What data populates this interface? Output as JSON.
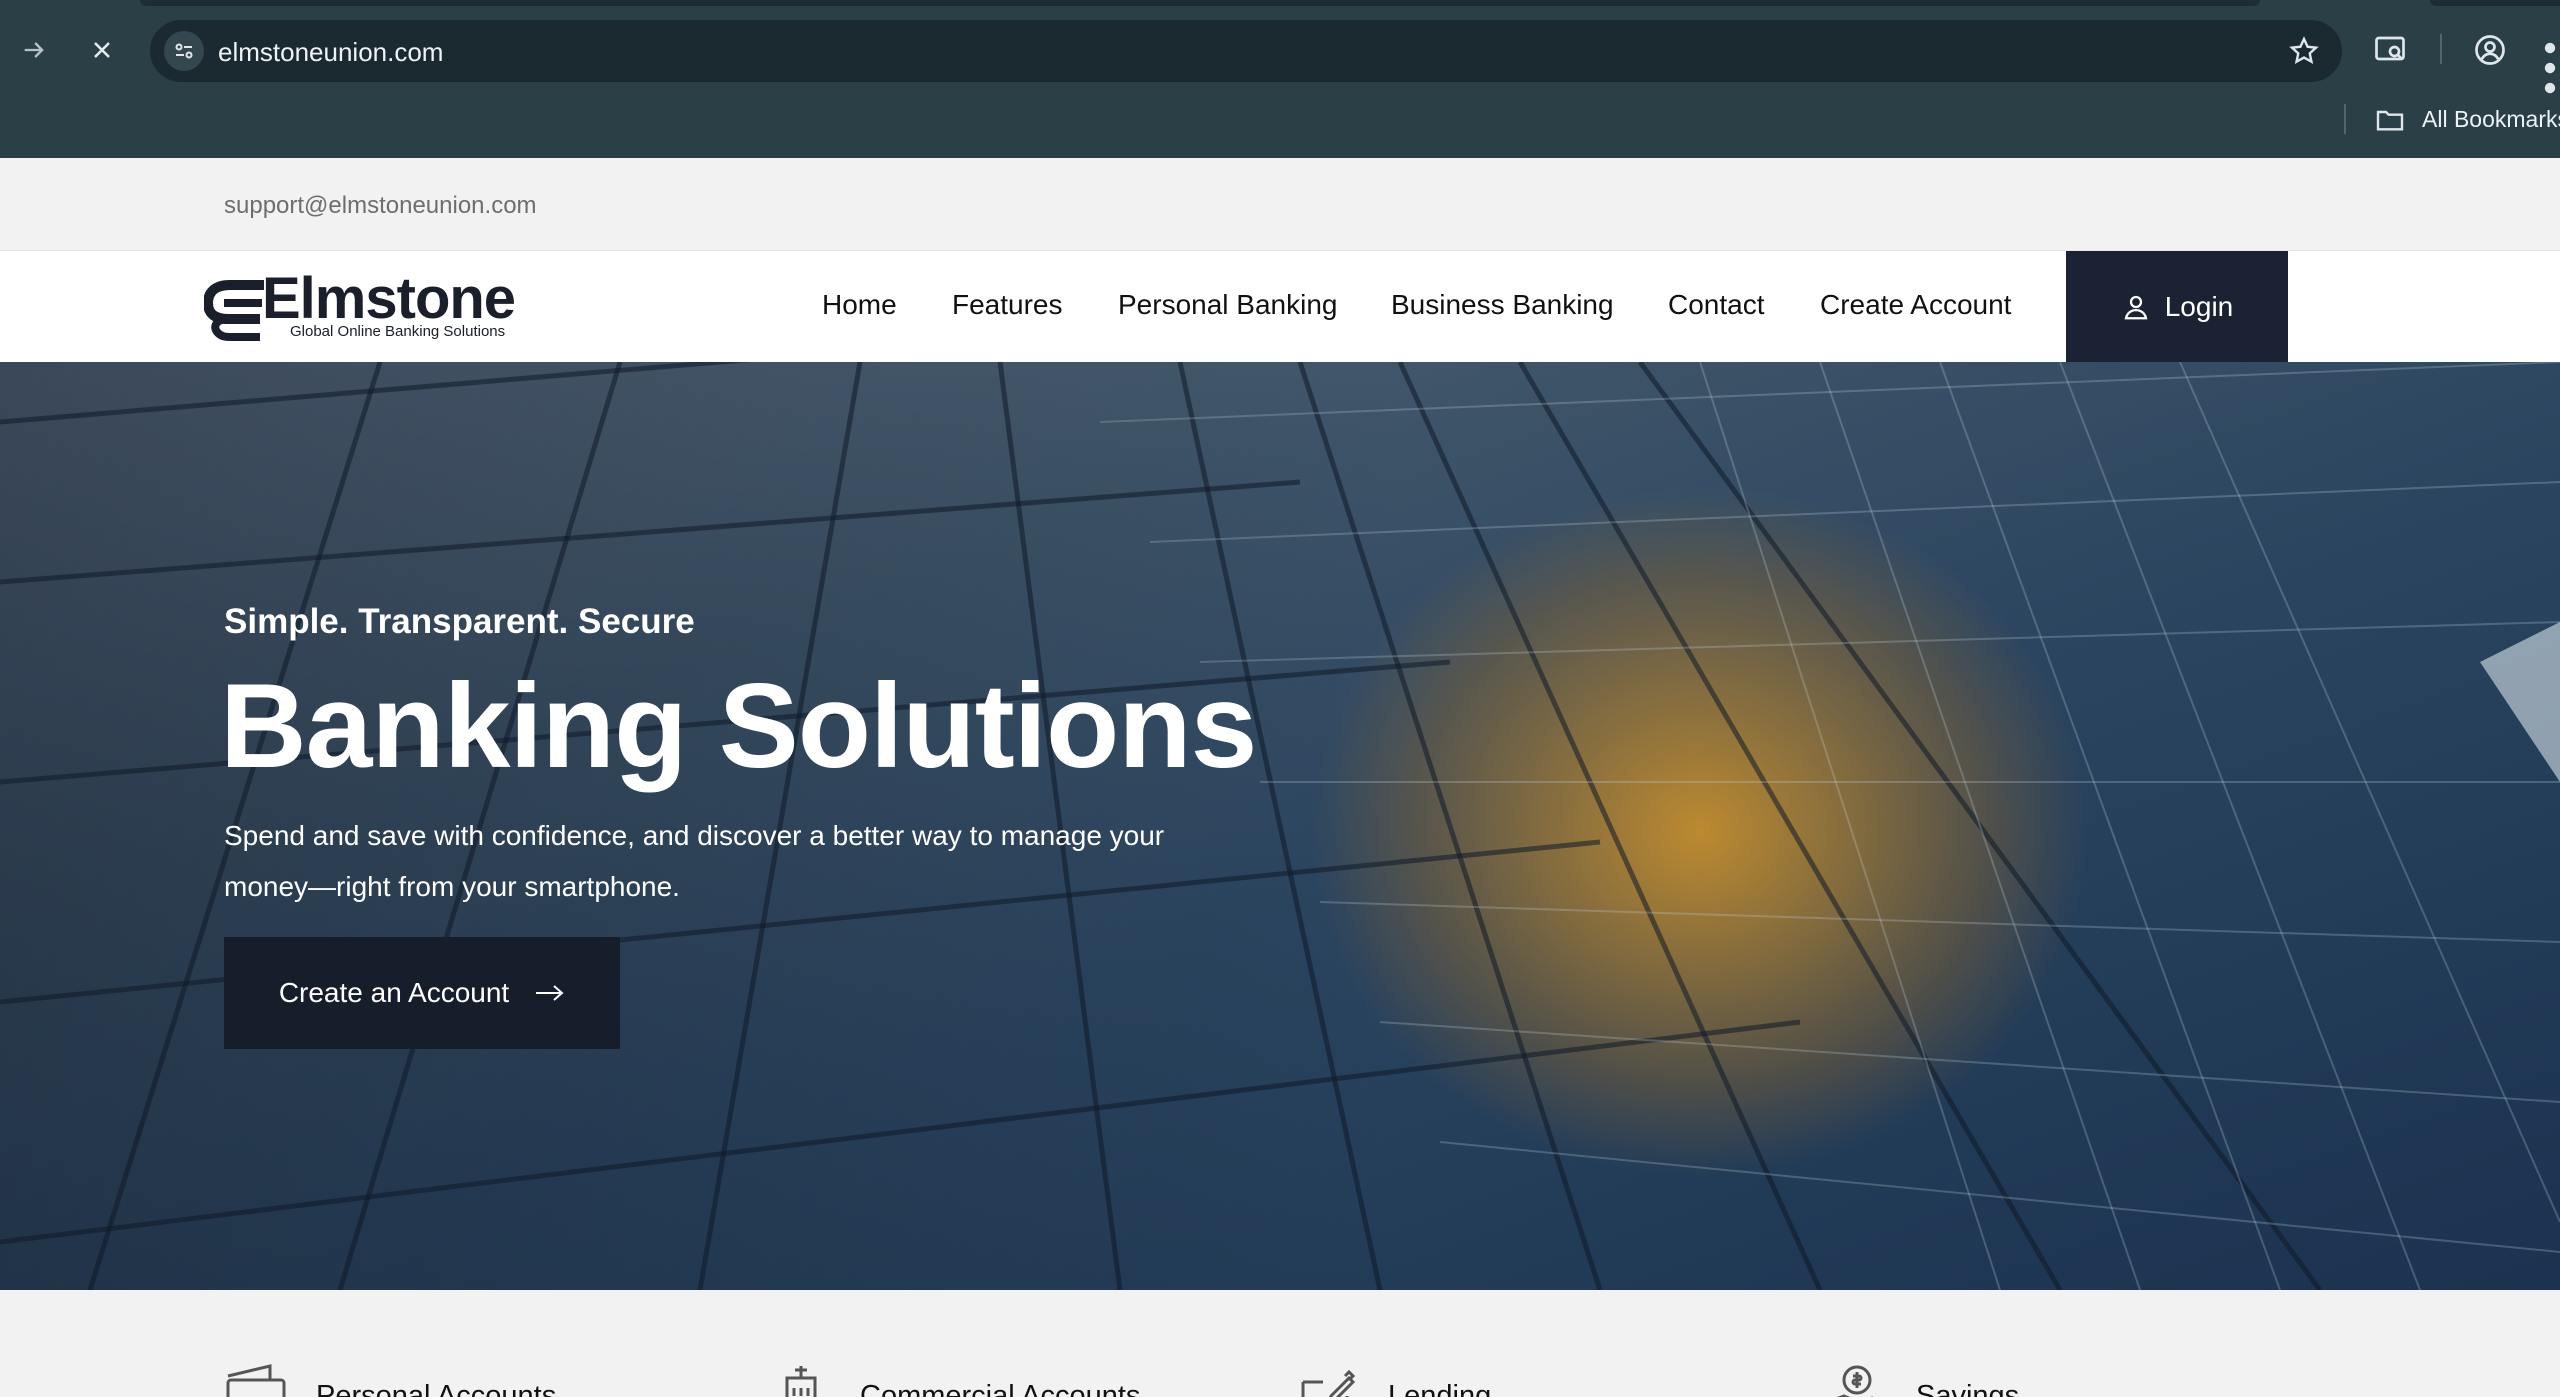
{
  "browser": {
    "url": "elmstoneunion.com",
    "bookmarks_label": "All Bookmarks",
    "icons": [
      "forward-arrow-icon",
      "stop-loading-icon",
      "site-info-icon",
      "bookmark-star-icon",
      "cast-search-icon",
      "profile-icon",
      "more-menu-icon",
      "folder-icon"
    ]
  },
  "topbar": {
    "email": "support@elmstoneunion.com"
  },
  "header": {
    "logo_name": "Elmstone",
    "logo_tagline": "Global Online Banking Solutions",
    "nav": [
      "Home",
      "Features",
      "Personal Banking",
      "Business Banking",
      "Contact",
      "Create Account"
    ],
    "login_label": "Login"
  },
  "hero": {
    "tagline": "Simple. Transparent. Secure",
    "title": "Banking Solutions",
    "description": "Spend and save with confidence, and discover a better way to manage your money—right from your smartphone.",
    "cta_label": "Create an Account"
  },
  "features": [
    {
      "label": "Personal Accounts",
      "icon": "wallet-icon"
    },
    {
      "label": "Commercial Accounts",
      "icon": "building-icon"
    },
    {
      "label": "Lending",
      "icon": "document-pen-icon"
    },
    {
      "label": "Savings",
      "icon": "money-hand-icon"
    }
  ],
  "colors": {
    "chrome": "#2b3f47",
    "dark_navy": "#1b2233",
    "hero_glow": "#d69628"
  }
}
